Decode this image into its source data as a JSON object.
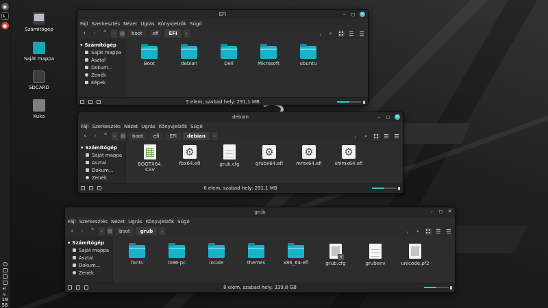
{
  "desktop": {
    "icons": [
      {
        "label": "Számítógép",
        "icon": "computer-icon"
      },
      {
        "label": "Saját mappa",
        "icon": "home-folder-icon"
      },
      {
        "label": "SDCARD",
        "icon": "sdcard-icon"
      },
      {
        "label": "Kuka",
        "icon": "trash-icon"
      }
    ]
  },
  "panel": {
    "clock_hour": "19",
    "clock_minute": "56",
    "terminal_glyph": "$_"
  },
  "menu": [
    "Fájl",
    "Szerkesztés",
    "Nézet",
    "Ugrás",
    "Könyvjelzők",
    "Súgó"
  ],
  "colors": {
    "accent": "#3cc3c7",
    "folder": "#19b3c9"
  },
  "windows": {
    "efi": {
      "title": "EFI",
      "breadcrumb": [
        "boot",
        "efi",
        "EFI"
      ],
      "sidebar": {
        "header": "Számítógép",
        "items": [
          "Saját mappa",
          "Asztal",
          "Dokum...",
          "Zenék",
          "Képek"
        ]
      },
      "items": [
        {
          "name": "Boot",
          "type": "folder"
        },
        {
          "name": "debian",
          "type": "folder"
        },
        {
          "name": "Dell",
          "type": "folder"
        },
        {
          "name": "Microsoft",
          "type": "folder"
        },
        {
          "name": "ubuntu",
          "type": "folder"
        }
      ],
      "status": "5 elem, szabad hely: 291,1 MB"
    },
    "debian": {
      "title": "debian",
      "breadcrumb": [
        "boot",
        "efi",
        "EFI",
        "debian"
      ],
      "sidebar": {
        "header": "Számítógép",
        "items": [
          "Saját mappa",
          "Asztal",
          "Dokum...",
          "Zenék"
        ]
      },
      "items": [
        {
          "name": "BOOTX64.\nCSV",
          "type": "spreadsheet"
        },
        {
          "name": "fbx64.efi",
          "type": "executable"
        },
        {
          "name": "grub.cfg",
          "type": "text"
        },
        {
          "name": "grubx64.efi",
          "type": "executable"
        },
        {
          "name": "mmx64.efi",
          "type": "executable"
        },
        {
          "name": "shimx64.efi",
          "type": "executable"
        }
      ],
      "status": "6 elem, szabad hely: 291,1 MB"
    },
    "grub": {
      "title": "grub",
      "breadcrumb": [
        "boot",
        "grub"
      ],
      "sidebar": {
        "header": "Számítógép",
        "items": [
          "Saját mappa",
          "Asztal",
          "Dokum...",
          "Zenék"
        ]
      },
      "items": [
        {
          "name": "fonts",
          "type": "folder"
        },
        {
          "name": "i386-pc",
          "type": "folder"
        },
        {
          "name": "locale",
          "type": "folder"
        },
        {
          "name": "themes",
          "type": "folder"
        },
        {
          "name": "x86_64-efi",
          "type": "folder"
        },
        {
          "name": "grub.cfg",
          "type": "text-broken"
        },
        {
          "name": "grubenv",
          "type": "text"
        },
        {
          "name": "unicode.pf2",
          "type": "font"
        }
      ],
      "status": "8 elem, szabad hely: 339,8 GB"
    }
  }
}
